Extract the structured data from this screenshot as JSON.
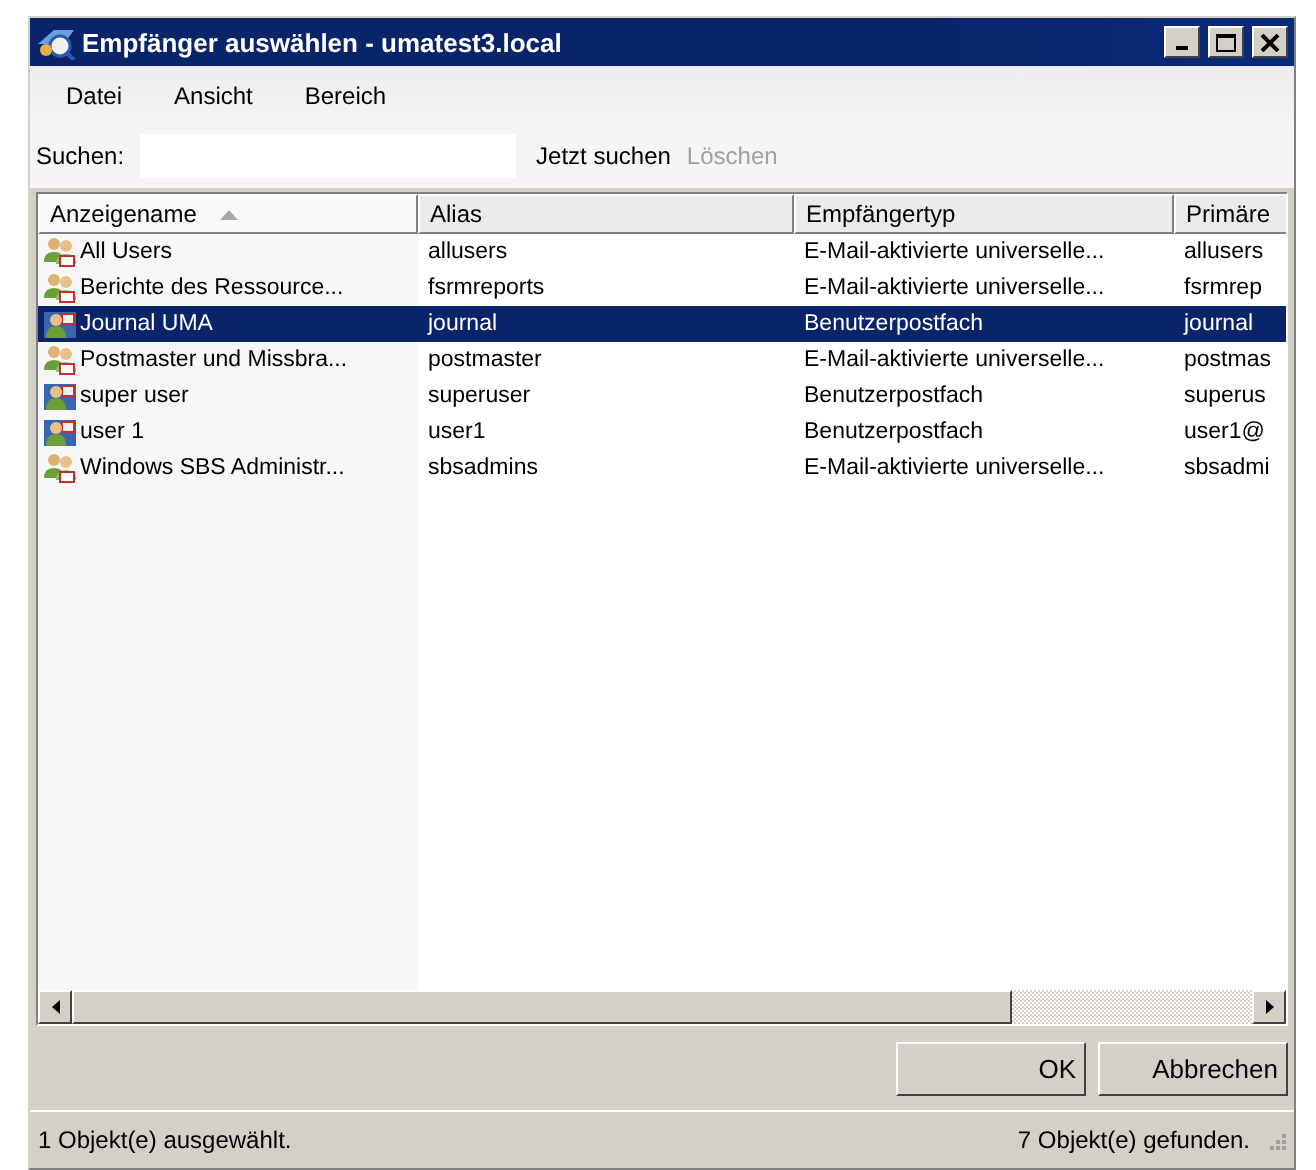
{
  "window": {
    "title": "Empfänger auswählen - umatest3.local"
  },
  "menu": [
    "Datei",
    "Ansicht",
    "Bereich"
  ],
  "search": {
    "label": "Suchen:",
    "actions": [
      {
        "label": "Jetzt suchen",
        "disabled": false
      },
      {
        "label": "Löschen",
        "disabled": true
      }
    ]
  },
  "table": {
    "columns": [
      {
        "label": "Anzeigename",
        "sorted": true
      },
      {
        "label": "Alias",
        "sorted": false
      },
      {
        "label": "Empfängertyp",
        "sorted": false
      },
      {
        "label": "Primäre",
        "sorted": false
      }
    ],
    "rows": [
      {
        "kind": "group",
        "selected": false,
        "cells": [
          "All Users",
          "allusers",
          "E-Mail-aktivierte universelle...",
          "allusers"
        ]
      },
      {
        "kind": "group",
        "selected": false,
        "cells": [
          "Berichte des Ressource...",
          "fsrmreports",
          "E-Mail-aktivierte universelle...",
          "fsrmrep"
        ]
      },
      {
        "kind": "mailbox",
        "selected": true,
        "cells": [
          "Journal UMA",
          "journal",
          "Benutzerpostfach",
          "journal"
        ]
      },
      {
        "kind": "group",
        "selected": false,
        "cells": [
          "Postmaster und Missbra...",
          "postmaster",
          "E-Mail-aktivierte universelle...",
          "postmas"
        ]
      },
      {
        "kind": "mailbox",
        "selected": false,
        "cells": [
          "super user",
          "superuser",
          "Benutzerpostfach",
          "superus"
        ]
      },
      {
        "kind": "mailbox",
        "selected": false,
        "cells": [
          "user 1",
          "user1",
          "Benutzerpostfach",
          "user1@"
        ]
      },
      {
        "kind": "group",
        "selected": false,
        "cells": [
          "Windows SBS Administr...",
          "sbsadmins",
          "E-Mail-aktivierte universelle...",
          "sbsadmi"
        ]
      }
    ]
  },
  "buttons": [
    "OK",
    "Abbrechen"
  ],
  "status_bar": {
    "left": "1 Objekt(e) ausgewählt.",
    "right": "7 Objekt(e) gefunden."
  }
}
